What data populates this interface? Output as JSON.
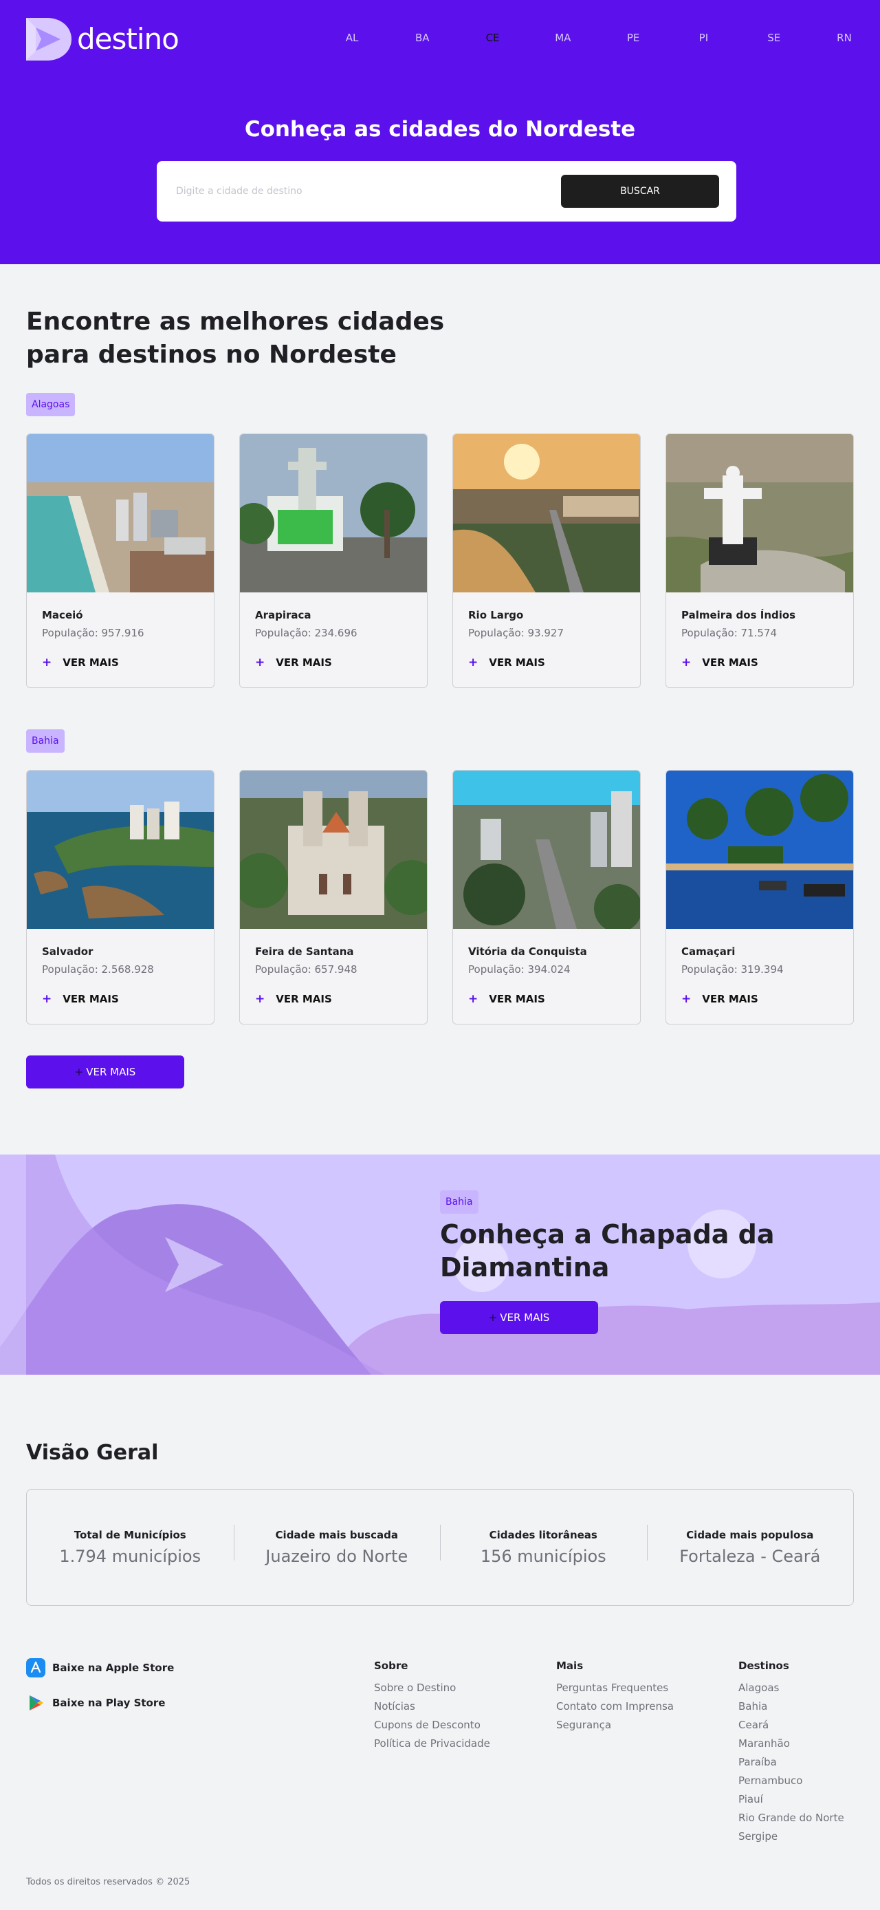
{
  "brand": {
    "name": "destino",
    "primary_color": "#5b10ec",
    "dark_color": "#1e1e1e"
  },
  "nav": [
    {
      "label": "AL",
      "active": false
    },
    {
      "label": "BA",
      "active": false
    },
    {
      "label": "CE",
      "active": true
    },
    {
      "label": "MA",
      "active": false
    },
    {
      "label": "PE",
      "active": false
    },
    {
      "label": "PI",
      "active": false
    },
    {
      "label": "SE",
      "active": false
    },
    {
      "label": "RN",
      "active": false
    }
  ],
  "hero": {
    "title": "Conheça as cidades do Nordeste",
    "search_placeholder": "Digite a cidade de destino",
    "search_button": "BUSCAR"
  },
  "main": {
    "title": "Encontre as melhores cidades para destinos no Nordeste",
    "see_more_label": "VER MAIS",
    "groups": [
      {
        "state": "Alagoas",
        "cities": [
          {
            "name": "Maceió",
            "population": "População: 957.916",
            "image": "beach-city-photo"
          },
          {
            "name": "Arapiraca",
            "population": "População: 234.696",
            "image": "church-night-photo"
          },
          {
            "name": "Rio Largo",
            "population": "População: 93.927",
            "image": "sunset-river-photo"
          },
          {
            "name": "Palmeira dos Índios",
            "population": "População: 71.574",
            "image": "statue-hill-photo"
          }
        ]
      },
      {
        "state": "Bahia",
        "cities": [
          {
            "name": "Salvador",
            "population": "População: 2.568.928",
            "image": "coastline-photo"
          },
          {
            "name": "Feira de Santana",
            "population": "População: 657.948",
            "image": "cathedral-photo"
          },
          {
            "name": "Vitória da Conquista",
            "population": "População: 394.024",
            "image": "avenue-photo"
          },
          {
            "name": "Camaçari",
            "population": "População: 319.394",
            "image": "palm-beach-photo"
          }
        ]
      }
    ],
    "load_more_button": "VER MAIS"
  },
  "banner": {
    "tag": "Bahia",
    "title": "Conheça a Chapada da Diamantina",
    "button": "VER MAIS"
  },
  "overview": {
    "title": "Visão Geral",
    "items": [
      {
        "label": "Total de Municípios",
        "value": "1.794 municípios"
      },
      {
        "label": "Cidade mais buscada",
        "value": "Juazeiro do Norte"
      },
      {
        "label": "Cidades litorâneas",
        "value": "156 municípios"
      },
      {
        "label": "Cidade mais populosa",
        "value": "Fortaleza - Ceará"
      }
    ]
  },
  "footer": {
    "stores": [
      {
        "label": "Baixe na Apple Store",
        "icon": "apple-store-icon"
      },
      {
        "label": "Baixe na Play Store",
        "icon": "play-store-icon"
      }
    ],
    "columns": [
      {
        "title": "Sobre",
        "links": [
          "Sobre o Destino",
          "Notícias",
          "Cupons de Desconto",
          "Política de Privacidade"
        ]
      },
      {
        "title": "Mais",
        "links": [
          "Perguntas Frequentes",
          "Contato com Imprensa",
          "Segurança"
        ]
      },
      {
        "title": "Destinos",
        "links": [
          "Alagoas",
          "Bahia",
          "Ceará",
          "Maranhão",
          "Paraíba",
          "Pernambuco",
          "Piauí",
          "Rio Grande do Norte",
          "Sergipe"
        ]
      }
    ],
    "copyright": "Todos os direitos reservados © 2025"
  }
}
